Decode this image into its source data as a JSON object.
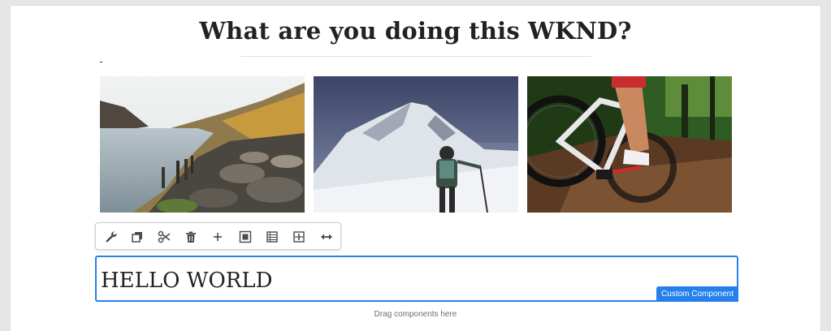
{
  "page": {
    "title": "What are you doing this WKND?"
  },
  "images": [
    {
      "name": "lake-hikers-photo"
    },
    {
      "name": "mountain-climber-photo"
    },
    {
      "name": "mountain-bike-photo"
    }
  ],
  "toolbar": {
    "icons": [
      "wrench-icon",
      "copy-icon",
      "cut-icon",
      "delete-icon",
      "add-icon",
      "group-icon",
      "layout-icon",
      "insert-icon",
      "resize-icon"
    ]
  },
  "component": {
    "text": "HELLO WORLD",
    "badge_label": "Custom Component"
  },
  "drop_zone": {
    "hint": "Drag components here"
  },
  "colors": {
    "accent": "#2680eb",
    "title_text": "#222222",
    "background": "#e6e6e6"
  }
}
